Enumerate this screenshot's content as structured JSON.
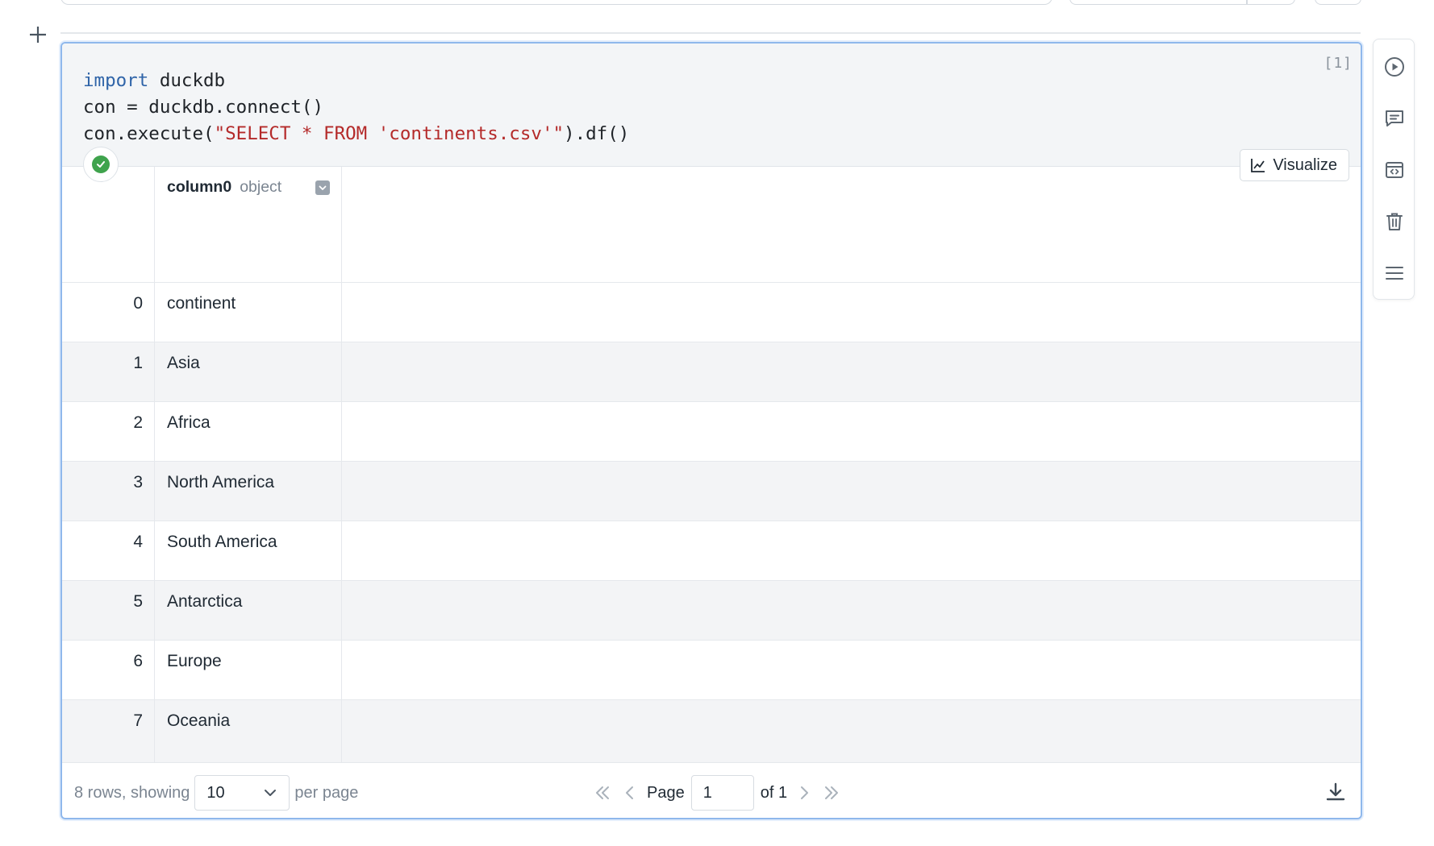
{
  "code": {
    "line1_kw": "import",
    "line1_rest": " duckdb",
    "line2": "con = duckdb.connect()",
    "line3_pre": "con.execute(",
    "line3_str": "\"SELECT * FROM 'continents.csv'\"",
    "line3_post": ").df()",
    "exec_count": "[1]"
  },
  "output": {
    "visualize_label": "Visualize",
    "column": {
      "name": "column0",
      "dtype": "object"
    },
    "rows": [
      {
        "index": "0",
        "value": "continent"
      },
      {
        "index": "1",
        "value": "Asia"
      },
      {
        "index": "2",
        "value": "Africa"
      },
      {
        "index": "3",
        "value": "North America"
      },
      {
        "index": "4",
        "value": "South America"
      },
      {
        "index": "5",
        "value": "Antarctica"
      },
      {
        "index": "6",
        "value": "Europe"
      },
      {
        "index": "7",
        "value": "Oceania"
      }
    ]
  },
  "footer": {
    "rows_text": "8 rows, showing",
    "per_page_value": "10",
    "per_page_text": "per page",
    "page_label": "Page",
    "page_value": "1",
    "of_text": "of 1"
  },
  "toolbar": {
    "icons": [
      "play-icon",
      "comment-icon",
      "code-toggle-icon",
      "trash-icon",
      "menu-icon"
    ]
  },
  "colors": {
    "accent_border": "#8fb8ec",
    "keyword": "#2f64a8",
    "string": "#b42a2a",
    "success": "#3fa34d"
  }
}
